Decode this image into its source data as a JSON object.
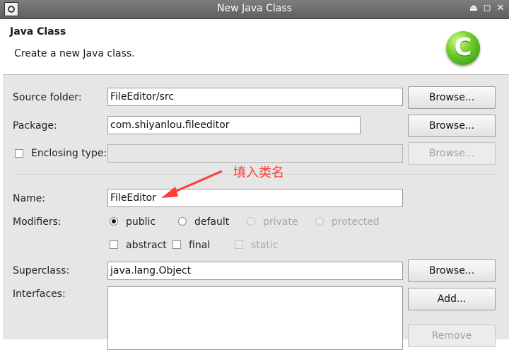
{
  "window": {
    "title": "New Java Class"
  },
  "header": {
    "title": "Java Class",
    "description": "Create a new Java class."
  },
  "form": {
    "source_folder": {
      "label": "Source folder:",
      "value": "FileEditor/src",
      "button": "Browse..."
    },
    "package": {
      "label": "Package:",
      "value": "com.shiyanlou.fileeditor",
      "button": "Browse..."
    },
    "enclosing_type": {
      "label": "Enclosing type:",
      "value": "",
      "button": "Browse...",
      "checked": false
    },
    "name": {
      "label": "Name:",
      "value": "FileEditor"
    },
    "modifiers": {
      "label": "Modifiers:",
      "access": [
        {
          "label": "public",
          "checked": true,
          "enabled": true
        },
        {
          "label": "default",
          "checked": false,
          "enabled": true
        },
        {
          "label": "private",
          "checked": false,
          "enabled": false
        },
        {
          "label": "protected",
          "checked": false,
          "enabled": false
        }
      ],
      "flags": [
        {
          "label": "abstract",
          "checked": false,
          "enabled": true
        },
        {
          "label": "final",
          "checked": false,
          "enabled": true
        },
        {
          "label": "static",
          "checked": false,
          "enabled": false
        }
      ]
    },
    "superclass": {
      "label": "Superclass:",
      "value": "java.lang.Object",
      "button": "Browse..."
    },
    "interfaces": {
      "label": "Interfaces:",
      "add_button": "Add...",
      "remove_button": "Remove"
    }
  },
  "annotation": {
    "text": "填入类名",
    "color": "#ff3b3b"
  }
}
